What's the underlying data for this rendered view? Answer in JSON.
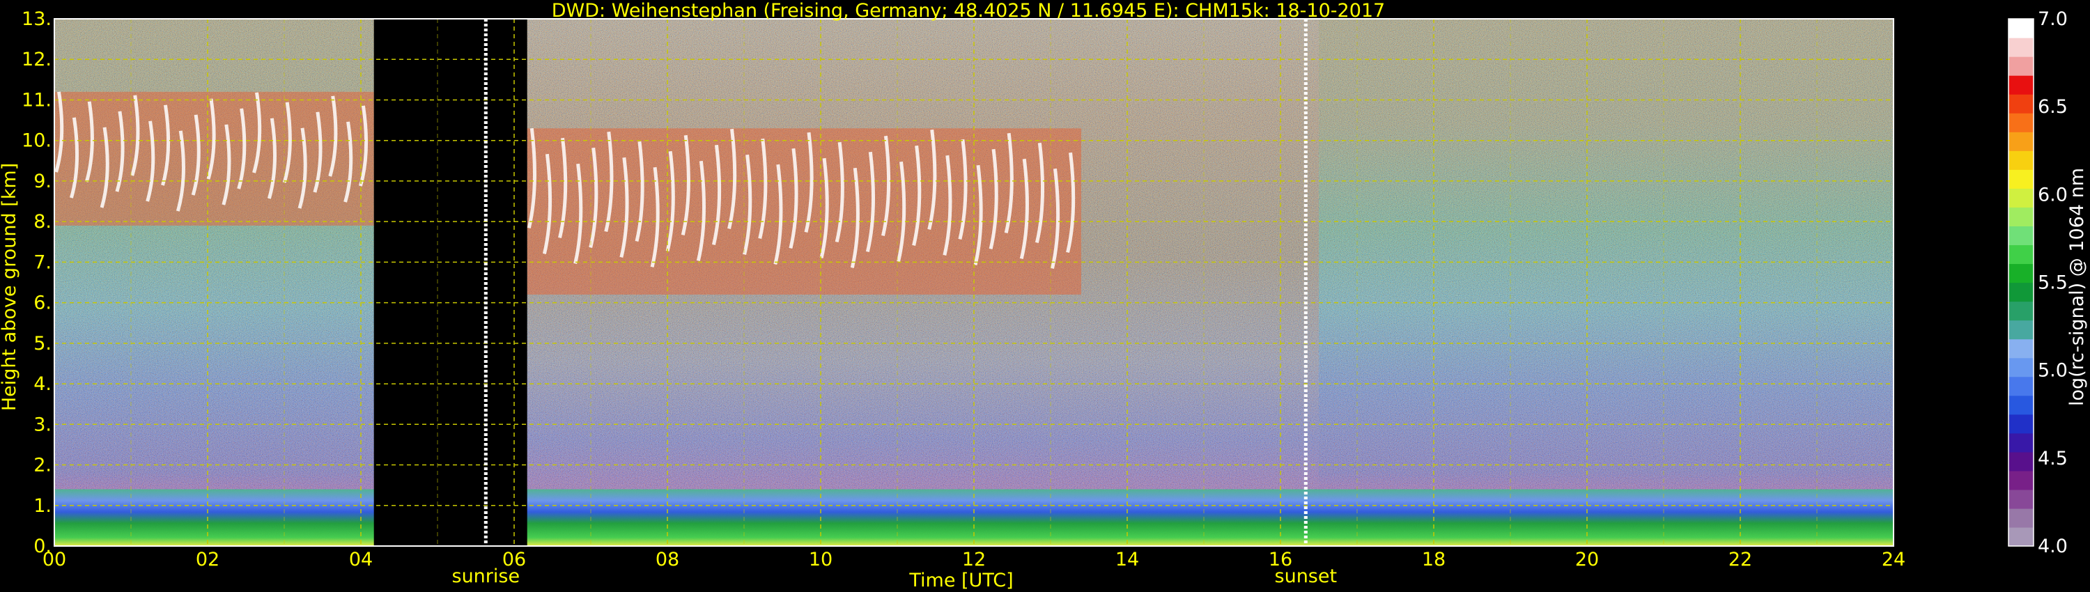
{
  "chart_data": {
    "type": "heatmap",
    "title": "DWD: Weihenstephan (Freising, Germany; 48.4025 N / 11.6945 E):    CHM15k: 18-10-2017",
    "xlabel": "Time [UTC]",
    "ylabel": "Height above ground [km]",
    "xlim": [
      0,
      24
    ],
    "ylim": [
      0,
      13
    ],
    "x_ticks": [
      "00",
      "02",
      "04",
      "06",
      "08",
      "10",
      "12",
      "14",
      "16",
      "18",
      "20",
      "22",
      "24"
    ],
    "y_ticks": [
      "0.",
      "1.",
      "2.",
      "3.",
      "4.",
      "5.",
      "6.",
      "7.",
      "8.",
      "9.",
      "10.",
      "11.",
      "12.",
      "13."
    ],
    "grid": true,
    "colorbar": {
      "label": "log(rc-signal) @ 1064 nm",
      "range": [
        4.0,
        7.0
      ],
      "ticks": [
        "4.0",
        "4.5",
        "5.0",
        "5.5",
        "6.0",
        "6.5",
        "7.0"
      ],
      "colors": [
        "#a898b8",
        "#9878a8",
        "#884898",
        "#782088",
        "#58108c",
        "#3818a8",
        "#2030c8",
        "#2858e0",
        "#4878ec",
        "#6898f0",
        "#88b0f0",
        "#48a8a0",
        "#28a068",
        "#109838",
        "#18b028",
        "#40d048",
        "#70e078",
        "#a0ec60",
        "#d0f040",
        "#f8f020",
        "#f8d010",
        "#f8a018",
        "#f87018",
        "#f04010",
        "#e81010",
        "#f0a0a0",
        "#f8d0d0",
        "#ffffff"
      ]
    },
    "annotations": [
      {
        "text": "sunrise",
        "x": 5.63
      },
      {
        "text": "sunset",
        "x": 16.33
      }
    ],
    "no_data_intervals": [
      [
        4.17,
        6.17
      ]
    ],
    "features": [
      {
        "type": "cirrus",
        "x_range": [
          0.0,
          4.17
        ],
        "height_km": [
          7.9,
          11.2
        ]
      },
      {
        "type": "cirrus",
        "x_range": [
          6.17,
          13.4
        ],
        "height_km": [
          6.2,
          10.3
        ]
      },
      {
        "type": "boundary_layer_aerosol",
        "x_range": [
          0,
          24
        ],
        "height_km": [
          0.0,
          1.4
        ]
      }
    ],
    "colors": {
      "axis_text": "#ffff00",
      "grid": "#c8c800",
      "marker_line": "#ffffff"
    }
  }
}
